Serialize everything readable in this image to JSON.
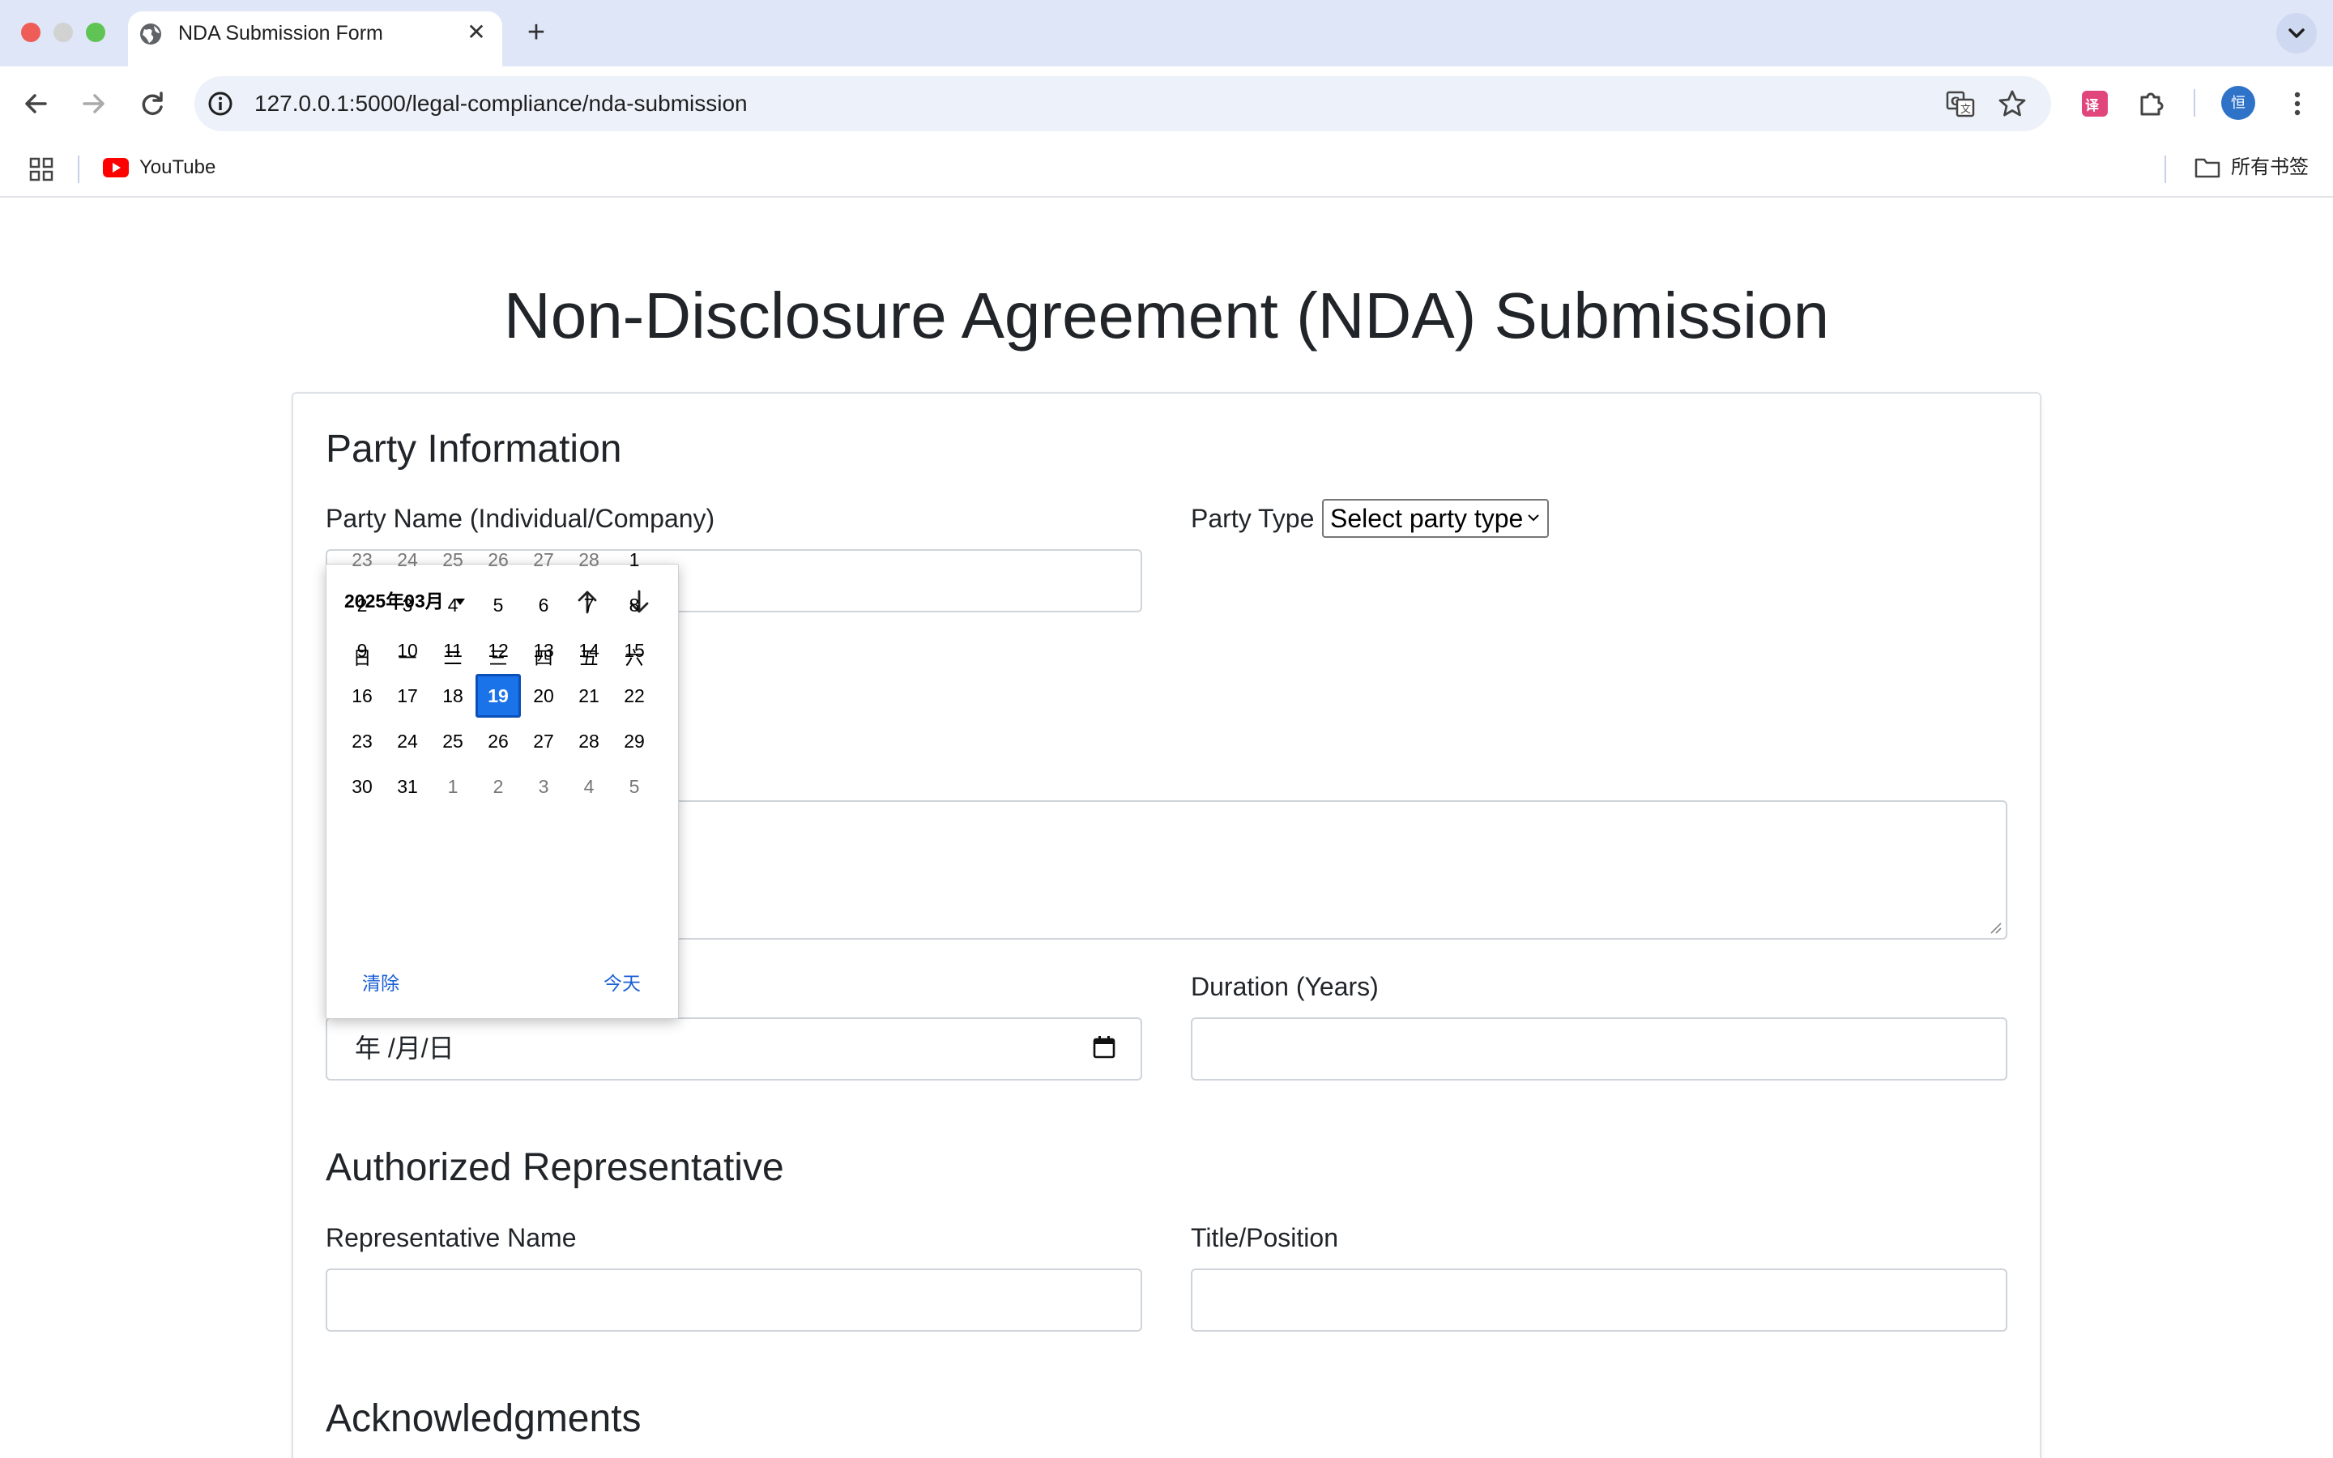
{
  "browser": {
    "tab_title": "NDA Submission Form",
    "url": "127.0.0.1:5000/legal-compliance/nda-submission",
    "bookmarks": [
      {
        "label": "YouTube",
        "icon": "youtube-icon"
      }
    ],
    "all_bookmarks_label": "所有书签",
    "avatar_letter": "恒"
  },
  "page": {
    "title": "Non-Disclosure Agreement (NDA) Submission",
    "sections": {
      "party_info": "Party Information",
      "authorized_rep": "Authorized Representative",
      "acknowledgments": "Acknowledgments"
    },
    "fields": {
      "party_name_label": "Party Name (Individual/Company)",
      "party_name_value": "",
      "party_type_label": "Party Type",
      "party_type_selected": "Select party type",
      "date_placeholder": "年 /月/日",
      "duration_label": "Duration (Years)",
      "duration_value": "",
      "rep_name_label": "Representative Name",
      "rep_name_value": "",
      "title_position_label": "Title/Position",
      "title_position_value": ""
    }
  },
  "date_picker": {
    "month_label": "2025年03月",
    "weekdays": [
      "日",
      "一",
      "二",
      "三",
      "四",
      "五",
      "六"
    ],
    "weeks": [
      [
        {
          "d": "23",
          "muted": true
        },
        {
          "d": "24",
          "muted": true
        },
        {
          "d": "25",
          "muted": true
        },
        {
          "d": "26",
          "muted": true
        },
        {
          "d": "27",
          "muted": true
        },
        {
          "d": "28",
          "muted": true
        },
        {
          "d": "1",
          "muted": false
        }
      ],
      [
        {
          "d": "2",
          "muted": false
        },
        {
          "d": "3",
          "muted": false
        },
        {
          "d": "4",
          "muted": false
        },
        {
          "d": "5",
          "muted": false
        },
        {
          "d": "6",
          "muted": false
        },
        {
          "d": "7",
          "muted": false
        },
        {
          "d": "8",
          "muted": false
        }
      ],
      [
        {
          "d": "9",
          "muted": false
        },
        {
          "d": "10",
          "muted": false
        },
        {
          "d": "11",
          "muted": false
        },
        {
          "d": "12",
          "muted": false
        },
        {
          "d": "13",
          "muted": false
        },
        {
          "d": "14",
          "muted": false
        },
        {
          "d": "15",
          "muted": false
        }
      ],
      [
        {
          "d": "16",
          "muted": false
        },
        {
          "d": "17",
          "muted": false
        },
        {
          "d": "18",
          "muted": false
        },
        {
          "d": "19",
          "muted": false,
          "selected": true
        },
        {
          "d": "20",
          "muted": false
        },
        {
          "d": "21",
          "muted": false
        },
        {
          "d": "22",
          "muted": false
        }
      ],
      [
        {
          "d": "23",
          "muted": false
        },
        {
          "d": "24",
          "muted": false
        },
        {
          "d": "25",
          "muted": false
        },
        {
          "d": "26",
          "muted": false
        },
        {
          "d": "27",
          "muted": false
        },
        {
          "d": "28",
          "muted": false
        },
        {
          "d": "29",
          "muted": false
        }
      ],
      [
        {
          "d": "30",
          "muted": false
        },
        {
          "d": "31",
          "muted": false
        },
        {
          "d": "1",
          "muted": true
        },
        {
          "d": "2",
          "muted": true
        },
        {
          "d": "3",
          "muted": true
        },
        {
          "d": "4",
          "muted": true
        },
        {
          "d": "5",
          "muted": true
        }
      ]
    ],
    "clear_label": "清除",
    "today_label": "今天"
  },
  "colors": {
    "accent": "#1a73e8",
    "tab_strip": "#dfe6f8",
    "omnibox": "#edf1fa",
    "input_border": "#ced4da",
    "text": "#212529"
  }
}
